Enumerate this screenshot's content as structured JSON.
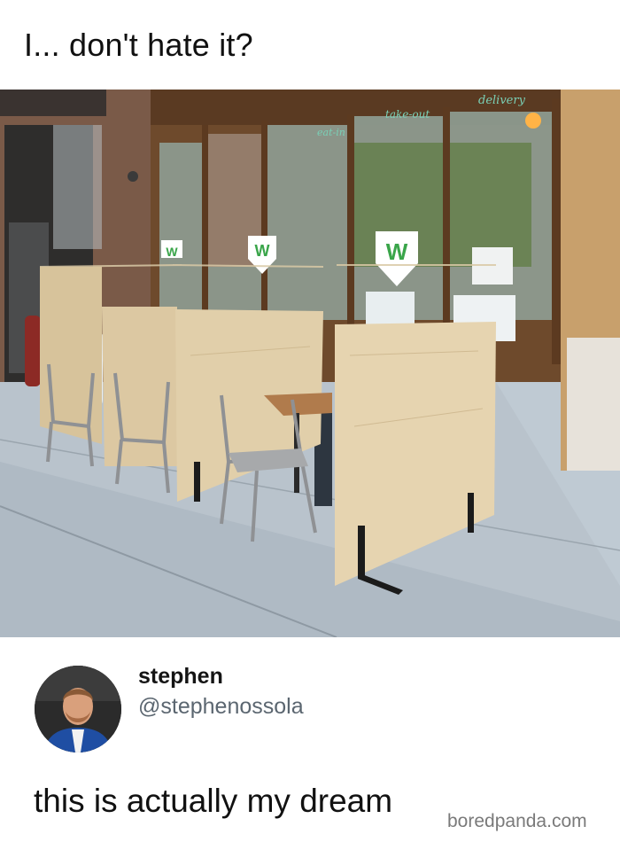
{
  "caption": "I... don't hate it?",
  "photo": {
    "window_signs": [
      "delivery",
      "take-out",
      "eat-in"
    ],
    "logo_letter": "W"
  },
  "tweet": {
    "display_name": "stephen",
    "handle": "@stephenossola",
    "text": "this is actually my dream"
  },
  "watermark": "boredpanda.com"
}
